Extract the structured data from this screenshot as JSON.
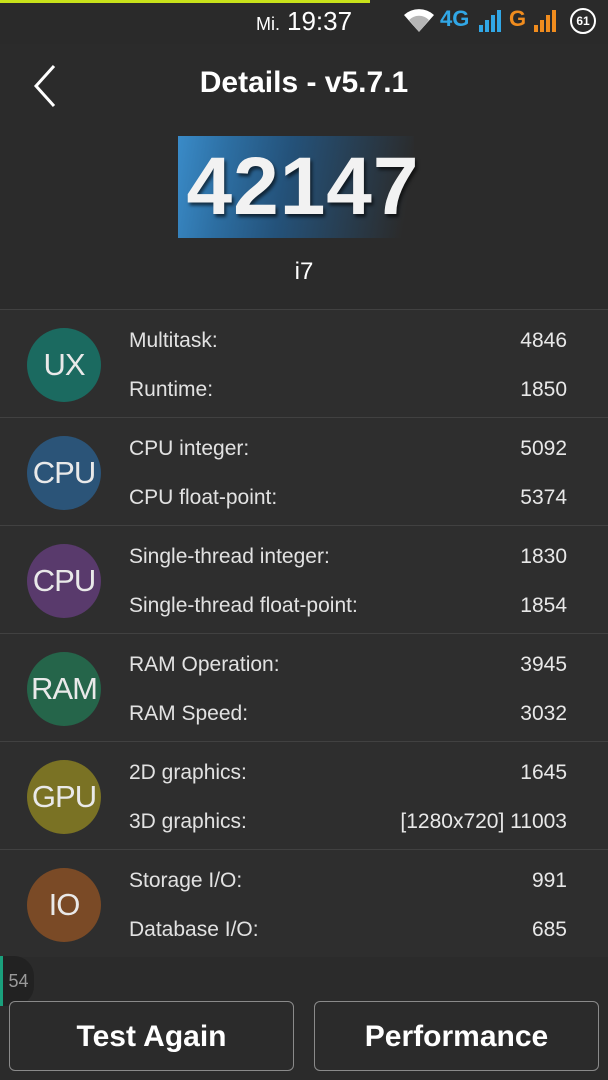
{
  "status_bar": {
    "day": "Mi.",
    "time": "19:37",
    "network_1": "4G",
    "network_2": "G",
    "battery": "61",
    "colors": {
      "network_1": "#31a7e6",
      "network_2": "#f08c1e"
    }
  },
  "header": {
    "title": "Details - v5.7.1",
    "back_icon": "chevron-left-icon"
  },
  "score": {
    "total": "42147",
    "device": "i7"
  },
  "categories": [
    {
      "badge": "UX",
      "color": "#1b6a60",
      "items": [
        {
          "label": "Multitask:",
          "value": "4846"
        },
        {
          "label": "Runtime:",
          "value": "1850"
        }
      ]
    },
    {
      "badge": "CPU",
      "color": "#2b5478",
      "items": [
        {
          "label": "CPU integer:",
          "value": "5092"
        },
        {
          "label": "CPU float-point:",
          "value": "5374"
        }
      ]
    },
    {
      "badge": "CPU",
      "color": "#593a6c",
      "items": [
        {
          "label": "Single-thread integer:",
          "value": "1830"
        },
        {
          "label": "Single-thread float-point:",
          "value": "1854"
        }
      ]
    },
    {
      "badge": "RAM",
      "color": "#25654a",
      "items": [
        {
          "label": "RAM Operation:",
          "value": "3945"
        },
        {
          "label": "RAM Speed:",
          "value": "3032"
        }
      ]
    },
    {
      "badge": "GPU",
      "color": "#7a7224",
      "items": [
        {
          "label": "2D graphics:",
          "value": "1645"
        },
        {
          "label": "3D graphics:",
          "value": "[1280x720] 11003"
        }
      ]
    },
    {
      "badge": "IO",
      "color": "#7a4a26",
      "items": [
        {
          "label": "Storage I/O:",
          "value": "991"
        },
        {
          "label": "Database I/O:",
          "value": "685"
        }
      ]
    }
  ],
  "side_counter": "54",
  "buttons": {
    "test_again": "Test Again",
    "performance": "Performance"
  }
}
